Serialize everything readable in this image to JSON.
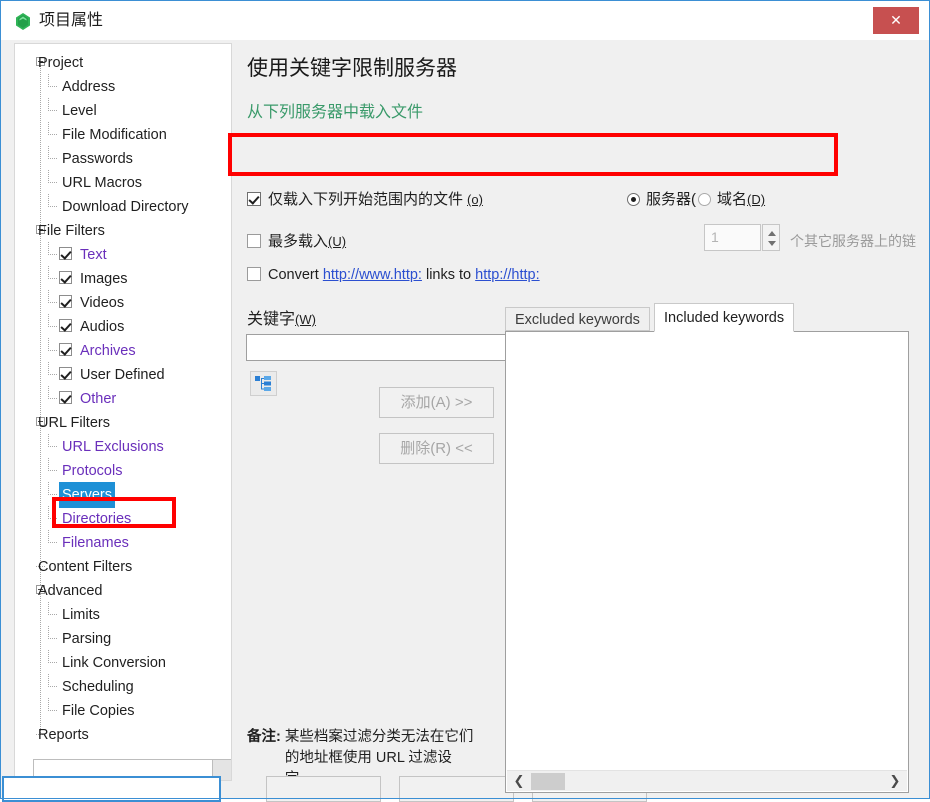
{
  "window": {
    "title": "项目属性",
    "title_icon": "gem-icon",
    "close_label": "✕",
    "accent_blue": "#3b8fd4",
    "close_red": "#c75050"
  },
  "tree": {
    "nodes": [
      {
        "label": "Project",
        "level": 0,
        "color": "dark",
        "expander": true,
        "checkbox": false,
        "selected": false
      },
      {
        "label": "Address",
        "level": 1,
        "color": "dark",
        "expander": false,
        "checkbox": false,
        "selected": false
      },
      {
        "label": "Level",
        "level": 1,
        "color": "dark",
        "expander": false,
        "checkbox": false,
        "selected": false
      },
      {
        "label": "File Modification",
        "level": 1,
        "color": "dark",
        "expander": false,
        "checkbox": false,
        "selected": false
      },
      {
        "label": "Passwords",
        "level": 1,
        "color": "dark",
        "expander": false,
        "checkbox": false,
        "selected": false
      },
      {
        "label": "URL Macros",
        "level": 1,
        "color": "dark",
        "expander": false,
        "checkbox": false,
        "selected": false
      },
      {
        "label": "Download Directory",
        "level": 1,
        "color": "dark",
        "expander": false,
        "checkbox": false,
        "selected": false
      },
      {
        "label": "File Filters",
        "level": 0,
        "color": "dark",
        "expander": true,
        "checkbox": false,
        "selected": false
      },
      {
        "label": "Text",
        "level": 1,
        "color": "purple",
        "expander": false,
        "checkbox": true,
        "selected": false
      },
      {
        "label": "Images",
        "level": 1,
        "color": "dark",
        "expander": false,
        "checkbox": true,
        "selected": false
      },
      {
        "label": "Videos",
        "level": 1,
        "color": "dark",
        "expander": false,
        "checkbox": true,
        "selected": false
      },
      {
        "label": "Audios",
        "level": 1,
        "color": "dark",
        "expander": false,
        "checkbox": true,
        "selected": false
      },
      {
        "label": "Archives",
        "level": 1,
        "color": "purple",
        "expander": false,
        "checkbox": true,
        "selected": false
      },
      {
        "label": "User Defined",
        "level": 1,
        "color": "dark",
        "expander": false,
        "checkbox": true,
        "selected": false
      },
      {
        "label": "Other",
        "level": 1,
        "color": "purple",
        "expander": false,
        "checkbox": true,
        "selected": false
      },
      {
        "label": "URL Filters",
        "level": 0,
        "color": "dark",
        "expander": true,
        "checkbox": false,
        "selected": false
      },
      {
        "label": "URL Exclusions",
        "level": 1,
        "color": "purple",
        "expander": false,
        "checkbox": false,
        "selected": false
      },
      {
        "label": "Protocols",
        "level": 1,
        "color": "purple",
        "expander": false,
        "checkbox": false,
        "selected": false
      },
      {
        "label": "Servers",
        "level": 1,
        "color": "purple",
        "expander": false,
        "checkbox": false,
        "selected": true
      },
      {
        "label": "Directories",
        "level": 1,
        "color": "purple",
        "expander": false,
        "checkbox": false,
        "selected": false
      },
      {
        "label": "Filenames",
        "level": 1,
        "color": "purple",
        "expander": false,
        "checkbox": false,
        "selected": false
      },
      {
        "label": "Content Filters",
        "level": 0,
        "color": "dark",
        "expander": false,
        "checkbox": false,
        "selected": false
      },
      {
        "label": "Advanced",
        "level": 0,
        "color": "dark",
        "expander": true,
        "checkbox": false,
        "selected": false
      },
      {
        "label": "Limits",
        "level": 1,
        "color": "dark",
        "expander": false,
        "checkbox": false,
        "selected": false
      },
      {
        "label": "Parsing",
        "level": 1,
        "color": "dark",
        "expander": false,
        "checkbox": false,
        "selected": false
      },
      {
        "label": "Link Conversion",
        "level": 1,
        "color": "dark",
        "expander": false,
        "checkbox": false,
        "selected": false
      },
      {
        "label": "Scheduling",
        "level": 1,
        "color": "dark",
        "expander": false,
        "checkbox": false,
        "selected": false
      },
      {
        "label": "File Copies",
        "level": 1,
        "color": "dark",
        "expander": false,
        "checkbox": false,
        "selected": false
      },
      {
        "label": "Reports",
        "level": 0,
        "color": "dark",
        "expander": false,
        "checkbox": false,
        "selected": false
      }
    ]
  },
  "main": {
    "page_title": "使用关键字限制服务器",
    "section_head": "从下列服务器中载入文件",
    "scope_checkbox": {
      "label": "仅载入下列开始范围内的文件",
      "accel": "(o)",
      "checked": true
    },
    "scope_radio_server": {
      "label": "服务器(",
      "checked": true
    },
    "scope_radio_domain": {
      "label": "域名",
      "accel": "(D)",
      "checked": false
    },
    "max_load": {
      "label": "最多载入",
      "accel": "(U)",
      "checked": false,
      "value": "1",
      "suffix": "个其它服务器上的链接 in all directories"
    },
    "convert": {
      "checked": false,
      "prefix": "Convert",
      "link_from": "http://www.http:",
      "middle": "links to",
      "link_to": "http://http:"
    },
    "keyword": {
      "label": "关键字",
      "accel": "(W)",
      "value": "",
      "tree_icon": "hierarchy-icon",
      "add_label": "添加(A)  >>",
      "remove_label": "删除(R)  <<"
    },
    "tabs": [
      {
        "label": "Excluded keywords",
        "active": false
      },
      {
        "label": "Included keywords",
        "active": true
      }
    ],
    "note": {
      "prefix": "备注:",
      "body": "某些档案过滤分类无法在它们的地址框使用 URL 过滤设定。"
    },
    "scrollbar": {
      "left_arrow": "❮",
      "right_arrow": "❯"
    }
  },
  "annotations": [
    {
      "name": "servers-highlight",
      "color": "#ff0000"
    },
    {
      "name": "scope-row-highlight",
      "color": "#ff0000"
    }
  ]
}
